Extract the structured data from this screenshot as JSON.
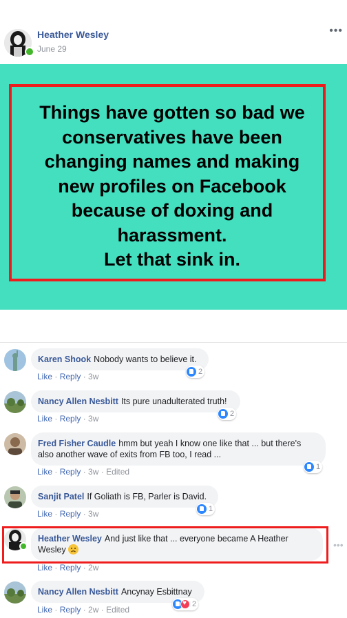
{
  "post": {
    "author": "Heather Wesley",
    "date": "June 29",
    "more": "•••",
    "image_text": "Things have gotten so bad we\nconservatives have been\nchanging names and making\nnew profiles on Facebook\nbecause of doxing and\nharassment.\nLet that sink in.",
    "banner_color": "#44dfbf",
    "box_color": "#ee1c1c"
  },
  "comments": [
    {
      "name": "Karen Shook",
      "text": "Nobody wants to believe it.",
      "like": "Like",
      "reply": "Reply",
      "time": "3w",
      "edited": "",
      "reactions": "2"
    },
    {
      "name": "Nancy Allen Nesbitt",
      "text": "Its pure unadulterated truth!",
      "like": "Like",
      "reply": "Reply",
      "time": "3w",
      "edited": "",
      "reactions": "2"
    },
    {
      "name": "Fred Fisher Caudle",
      "text": "hmm but yeah I know one like that ... but there's also another wave of exits from FB too, I read ...",
      "like": "Like",
      "reply": "Reply",
      "time": "3w",
      "edited": "Edited",
      "reactions": "1"
    },
    {
      "name": "Sanjit Patel",
      "text": "If Goliath is FB, Parler is David.",
      "like": "Like",
      "reply": "Reply",
      "time": "3w",
      "edited": "",
      "reactions": "1"
    },
    {
      "name": "Heather Wesley",
      "text": "And just like that ... everyone became A Heather Wesley",
      "emoji": "disappointed-face",
      "like": "Like",
      "reply": "Reply",
      "time": "2w",
      "edited": "",
      "reactions": ""
    },
    {
      "name": "Nancy Allen Nesbitt",
      "text": "Ancynay Esbittnay",
      "like": "Like",
      "reply": "Reply",
      "time": "2w",
      "edited": "Edited",
      "reactions": "2"
    }
  ],
  "separator": " · "
}
